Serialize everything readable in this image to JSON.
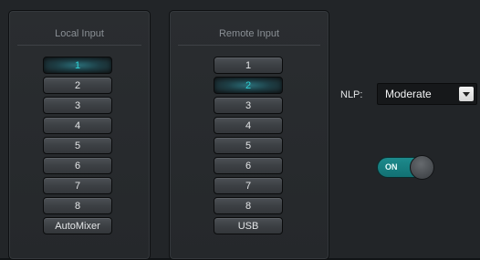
{
  "local_input": {
    "title": "Local Input",
    "buttons": [
      "1",
      "2",
      "3",
      "4",
      "5",
      "6",
      "7",
      "8",
      "AutoMixer"
    ],
    "selected": "1"
  },
  "remote_input": {
    "title": "Remote Input",
    "buttons": [
      "1",
      "2",
      "3",
      "4",
      "5",
      "6",
      "7",
      "8",
      "USB"
    ],
    "selected": "2"
  },
  "nlp": {
    "label": "NLP:",
    "value": "Moderate"
  },
  "toggle": {
    "label": "ON",
    "state": true
  },
  "colors": {
    "accent": "#1d8a8c",
    "active_text": "#2fd4d8",
    "background": "#222528"
  }
}
